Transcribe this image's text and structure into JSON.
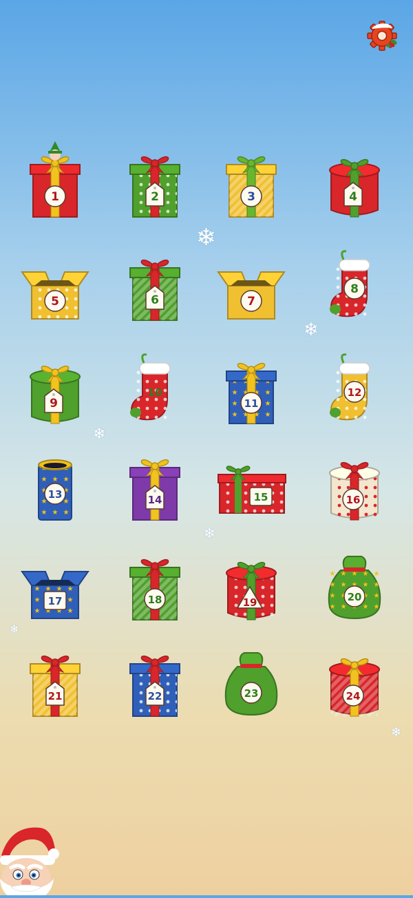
{
  "settings": {
    "icon": "gear-icon"
  },
  "days": [
    {
      "label": "1",
      "kind": "box",
      "box": "#d8262a",
      "stripe": "#f2c21e",
      "ribbon": "#f2c21e",
      "pattern": "plain",
      "tag": "round",
      "num": "#b0161e",
      "elf": true
    },
    {
      "label": "2",
      "kind": "box",
      "box": "#4fa02c",
      "stripe": "#d8262a",
      "ribbon": "#d8262a",
      "pattern": "dots",
      "tag": "tag",
      "num": "#2f7d1e"
    },
    {
      "label": "3",
      "kind": "box",
      "box": "#f0c030",
      "stripe": "#68b62e",
      "ribbon": "#68b62e",
      "pattern": "stripes",
      "tag": "round",
      "num": "#2b4fa0"
    },
    {
      "label": "4",
      "kind": "drum",
      "box": "#d8262a",
      "stripe": "#4fa02c",
      "ribbon": "#4fa02c",
      "pattern": "plain",
      "tag": "tag",
      "num": "#2f7d1e"
    },
    {
      "label": "5",
      "kind": "openbox",
      "box": "#f0c030",
      "stripe": "#d8262a",
      "ribbon": "#d8262a",
      "pattern": "dots",
      "tag": "round",
      "num": "#b0161e"
    },
    {
      "label": "6",
      "kind": "box",
      "box": "#4fa02c",
      "stripe": "#d8262a",
      "ribbon": "#d8262a",
      "pattern": "stripes",
      "tag": "tag",
      "num": "#2f7d1e"
    },
    {
      "label": "7",
      "kind": "openbox",
      "box": "#f0c030",
      "stripe": "#d8262a",
      "ribbon": "#d8262a",
      "pattern": "plain",
      "tag": "round",
      "num": "#b0161e"
    },
    {
      "label": "8",
      "kind": "stocking",
      "box": "#d8262a",
      "stripe": "#ffffff",
      "ribbon": "#4fa02c",
      "pattern": "dots",
      "tag": "round",
      "num": "#2f7d1e"
    },
    {
      "label": "9",
      "kind": "drum",
      "box": "#4fa02c",
      "stripe": "#f2c21e",
      "ribbon": "#f2c21e",
      "pattern": "plain",
      "tag": "tag",
      "num": "#b0161e"
    },
    {
      "label": "10",
      "kind": "stocking",
      "box": "#d8262a",
      "stripe": "#ffffff",
      "ribbon": "#4fa02c",
      "pattern": "dots",
      "tag": "none",
      "num": "#2f7d1e"
    },
    {
      "label": "11",
      "kind": "box",
      "box": "#2f5fb8",
      "stripe": "#f2c21e",
      "ribbon": "#f2c21e",
      "pattern": "stars",
      "tag": "round",
      "num": "#2b4fa0"
    },
    {
      "label": "12",
      "kind": "stocking",
      "box": "#f0c030",
      "stripe": "#ffffff",
      "ribbon": "#4fa02c",
      "pattern": "dots",
      "tag": "round",
      "num": "#b0161e"
    },
    {
      "label": "13",
      "kind": "tube",
      "box": "#2f5fb8",
      "stripe": "#f2c21e",
      "ribbon": "#f2c21e",
      "pattern": "stars",
      "tag": "round",
      "num": "#2b4fa0"
    },
    {
      "label": "14",
      "kind": "box",
      "box": "#7d3aa8",
      "stripe": "#f2c21e",
      "ribbon": "#f2c21e",
      "pattern": "plain",
      "tag": "tag",
      "num": "#5a2a86"
    },
    {
      "label": "15",
      "kind": "long",
      "box": "#d8262a",
      "stripe": "#4fa02c",
      "ribbon": "#4fa02c",
      "pattern": "dots",
      "tag": "label",
      "num": "#2f7d1e"
    },
    {
      "label": "16",
      "kind": "drum",
      "box": "#f3e6cf",
      "stripe": "#d8262a",
      "ribbon": "#d8262a",
      "pattern": "reddots",
      "tag": "round",
      "num": "#b0161e"
    },
    {
      "label": "17",
      "kind": "openbox",
      "box": "#2f5fb8",
      "stripe": "#f2c21e",
      "ribbon": "#f2c21e",
      "pattern": "stars",
      "tag": "label",
      "num": "#2b4fa0"
    },
    {
      "label": "18",
      "kind": "box",
      "box": "#4fa02c",
      "stripe": "#d8262a",
      "ribbon": "#d8262a",
      "pattern": "stripes",
      "tag": "round",
      "num": "#2f7d1e"
    },
    {
      "label": "19",
      "kind": "drum",
      "box": "#d8262a",
      "stripe": "#4fa02c",
      "ribbon": "#4fa02c",
      "pattern": "dots",
      "tag": "triangle",
      "num": "#b0161e"
    },
    {
      "label": "20",
      "kind": "sack",
      "box": "#4fa02c",
      "stripe": "#d8262a",
      "ribbon": "#d8262a",
      "pattern": "stars",
      "tag": "round",
      "num": "#2f7d1e"
    },
    {
      "label": "21",
      "kind": "box",
      "box": "#f0c030",
      "stripe": "#d8262a",
      "ribbon": "#d8262a",
      "pattern": "stripes",
      "tag": "tag",
      "num": "#b0161e"
    },
    {
      "label": "22",
      "kind": "box",
      "box": "#2f5fb8",
      "stripe": "#d8262a",
      "ribbon": "#d8262a",
      "pattern": "dots",
      "tag": "tag",
      "num": "#2b4fa0"
    },
    {
      "label": "23",
      "kind": "sack",
      "box": "#4fa02c",
      "stripe": "#d8262a",
      "ribbon": "#d8262a",
      "pattern": "plain",
      "tag": "round",
      "num": "#2f7d1e"
    },
    {
      "label": "24",
      "kind": "drum",
      "box": "#d8262a",
      "stripe": "#f2c21e",
      "ribbon": "#f2c21e",
      "pattern": "stripes",
      "tag": "round",
      "num": "#b0161e"
    }
  ]
}
